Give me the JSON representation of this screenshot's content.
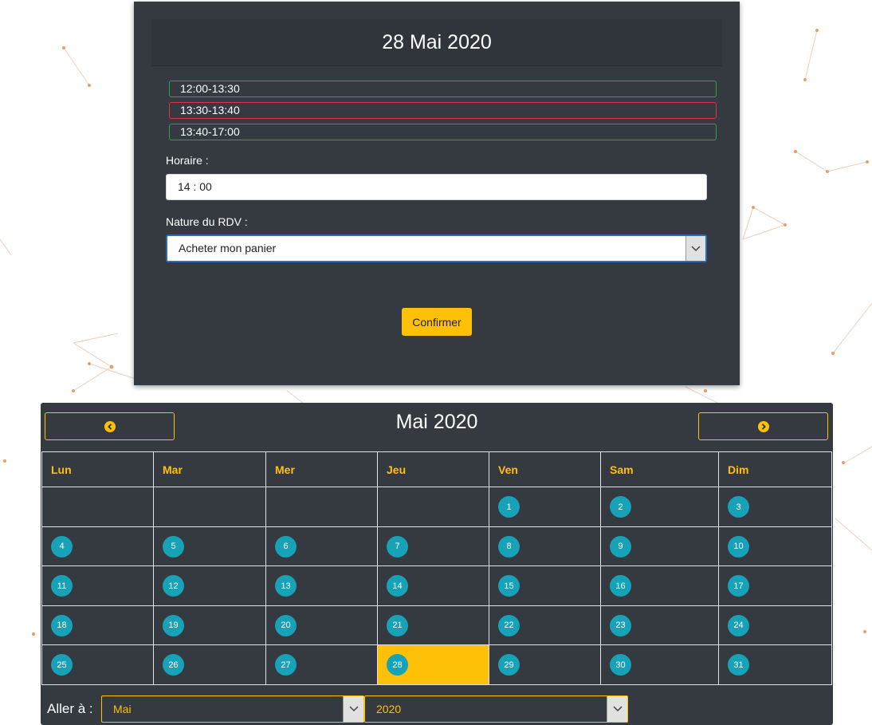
{
  "booking": {
    "date_title": "28 Mai 2020",
    "slots": [
      {
        "label": "12:00-13:30",
        "status": "available"
      },
      {
        "label": "13:30-13:40",
        "status": "busy"
      },
      {
        "label": "13:40-17:00",
        "status": "available"
      }
    ],
    "time_label": "Horaire :",
    "time_value": "14 : 00",
    "nature_label": "Nature du RDV :",
    "nature_value": "Acheter mon panier",
    "confirm_label": "Confirmer"
  },
  "calendar": {
    "title": "Mai 2020",
    "prev_icon": "chevron-left-circle-icon",
    "next_icon": "chevron-right-circle-icon",
    "weekdays": [
      "Lun",
      "Mar",
      "Mer",
      "Jeu",
      "Ven",
      "Sam",
      "Dim"
    ],
    "weeks": [
      [
        "",
        "",
        "",
        "",
        "1",
        "2",
        "3"
      ],
      [
        "4",
        "5",
        "6",
        "7",
        "8",
        "9",
        "10"
      ],
      [
        "11",
        "12",
        "13",
        "14",
        "15",
        "16",
        "17"
      ],
      [
        "18",
        "19",
        "20",
        "21",
        "22",
        "23",
        "24"
      ],
      [
        "25",
        "26",
        "27",
        "28",
        "29",
        "30",
        "31"
      ]
    ],
    "selected_day": "28",
    "goto_label": "Aller à :",
    "month_value": "Mai",
    "year_value": "2020"
  },
  "colors": {
    "panel": "#343a40",
    "accent": "#ffc107",
    "day_circle": "#17a2b8",
    "slot_available": "#28a745",
    "slot_busy": "#dc3545"
  }
}
